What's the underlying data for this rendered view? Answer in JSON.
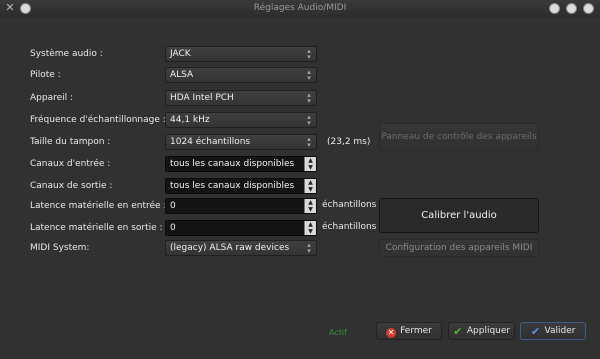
{
  "window": {
    "title": "Réglages Audio/MIDI"
  },
  "form": {
    "audio_system": {
      "label": "Système audio :",
      "value": "JACK"
    },
    "driver": {
      "label": "Pilote :",
      "value": "ALSA"
    },
    "device": {
      "label": "Appareil :",
      "value": "HDA Intel PCH"
    },
    "sample_rate": {
      "label": "Fréquence d'échantillonnage :",
      "value": "44,1 kHz"
    },
    "buffer_size": {
      "label": "Taille du tampon :",
      "value": "1024 échantillons",
      "latency": "(23,2 ms)"
    },
    "input_channels": {
      "label": "Canaux d'entrée :",
      "value": "tous les canaux disponibles"
    },
    "output_channels": {
      "label": "Canaux de sortie :",
      "value": "tous les canaux disponibles"
    },
    "hw_input_latency": {
      "label": "Latence matérielle en entrée :",
      "value": "0",
      "unit": "échantillons"
    },
    "hw_output_latency": {
      "label": "Latence matérielle en sortie :",
      "value": "0",
      "unit": "échantillons"
    },
    "midi_system": {
      "label": "MIDI System:",
      "value": "(legacy) ALSA raw devices"
    }
  },
  "buttons": {
    "control_panel": "Panneau de contrôle des appareils",
    "calibrate": "Calibrer l'audio",
    "midi_config": "Configuration des appareils MIDI",
    "close": "Fermer",
    "apply": "Appliquer",
    "ok": "Valider"
  },
  "status": {
    "text": "Actif"
  },
  "colors": {
    "close_icon": "#d23c2c",
    "check_icon": "#58b038"
  }
}
